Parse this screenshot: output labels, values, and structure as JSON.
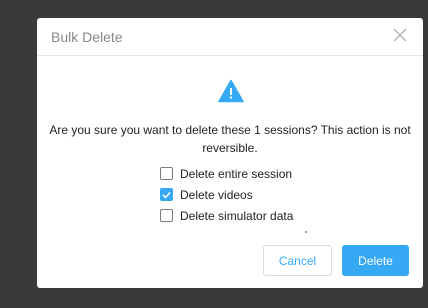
{
  "dialog": {
    "title": "Bulk Delete",
    "close_icon": "close-icon",
    "warning_icon": "warning-triangle-icon",
    "message": "Are you sure you want to delete these 1 sessions? This action is not reversible.",
    "options": [
      {
        "label": "Delete entire session",
        "checked": false
      },
      {
        "label": "Delete videos",
        "checked": true
      },
      {
        "label": "Delete simulator data",
        "checked": false
      }
    ],
    "cancel_label": "Cancel",
    "delete_label": "Delete"
  },
  "colors": {
    "accent": "#36a9f5",
    "overlay": "#3a3a3a",
    "title_text": "#888888"
  }
}
